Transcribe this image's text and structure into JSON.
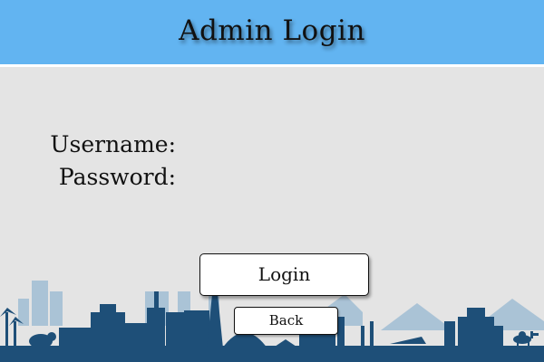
{
  "header": {
    "title": "Admin Login"
  },
  "form": {
    "username_label": "Username:",
    "password_label": "Password:",
    "username_value": "",
    "password_value": ""
  },
  "buttons": {
    "login_label": "Login",
    "back_label": "Back"
  },
  "colors": {
    "header_bg": "#62b4f1",
    "page_bg": "#e4e4e4",
    "skyline_dark": "#1e4f78",
    "skyline_light": "#aac3d6"
  },
  "decoration": {
    "background": "city-skyline-silhouette"
  }
}
